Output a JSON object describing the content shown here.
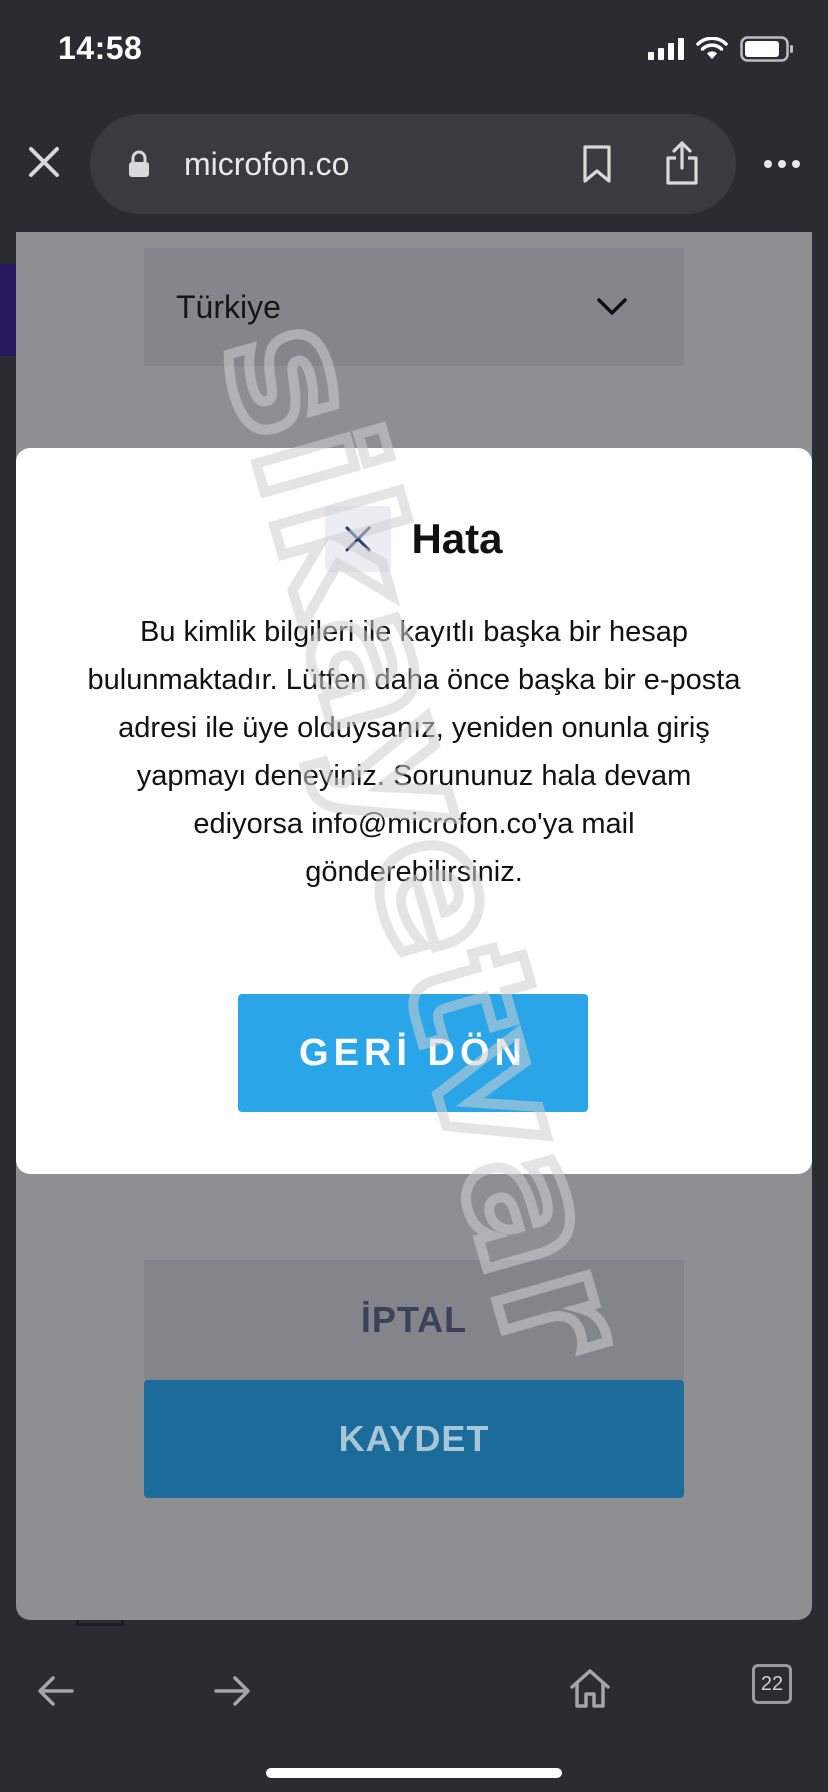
{
  "status_bar": {
    "time": "14:58"
  },
  "browser": {
    "url": "microfon.co",
    "tab_count": "22"
  },
  "form": {
    "country_value": "Türkiye",
    "cancel_label": "İPTAL",
    "save_label": "KAYDET"
  },
  "modal": {
    "title": "Hata",
    "message": "Bu kimlik bilgileri ile kayıtlı başka bir hesap bulunmaktadır. Lütfen daha önce başka bir e-posta adresi ile üye olduysanız, yeniden onunla giriş yapmayı deneyiniz. Sorununuz hala devam ediyorsa info@microfon.co'ya mail gönderebilirsiniz.",
    "button_label": "GERİ DÖN"
  },
  "watermark": {
    "text": "sikayetvar"
  },
  "colors": {
    "accent_blue": "#2aa5e8",
    "save_blue": "#1b6c9a",
    "chrome_dark": "#2b2c31"
  },
  "icons": {
    "close_tab": "close-icon",
    "lock": "lock-icon",
    "bookmark": "bookmark-icon",
    "share": "share-icon",
    "more": "more-icon",
    "dropdown": "chevron-down-icon",
    "modal_close": "close-icon",
    "back": "arrow-left-icon",
    "forward": "arrow-right-icon",
    "home": "home-icon"
  }
}
